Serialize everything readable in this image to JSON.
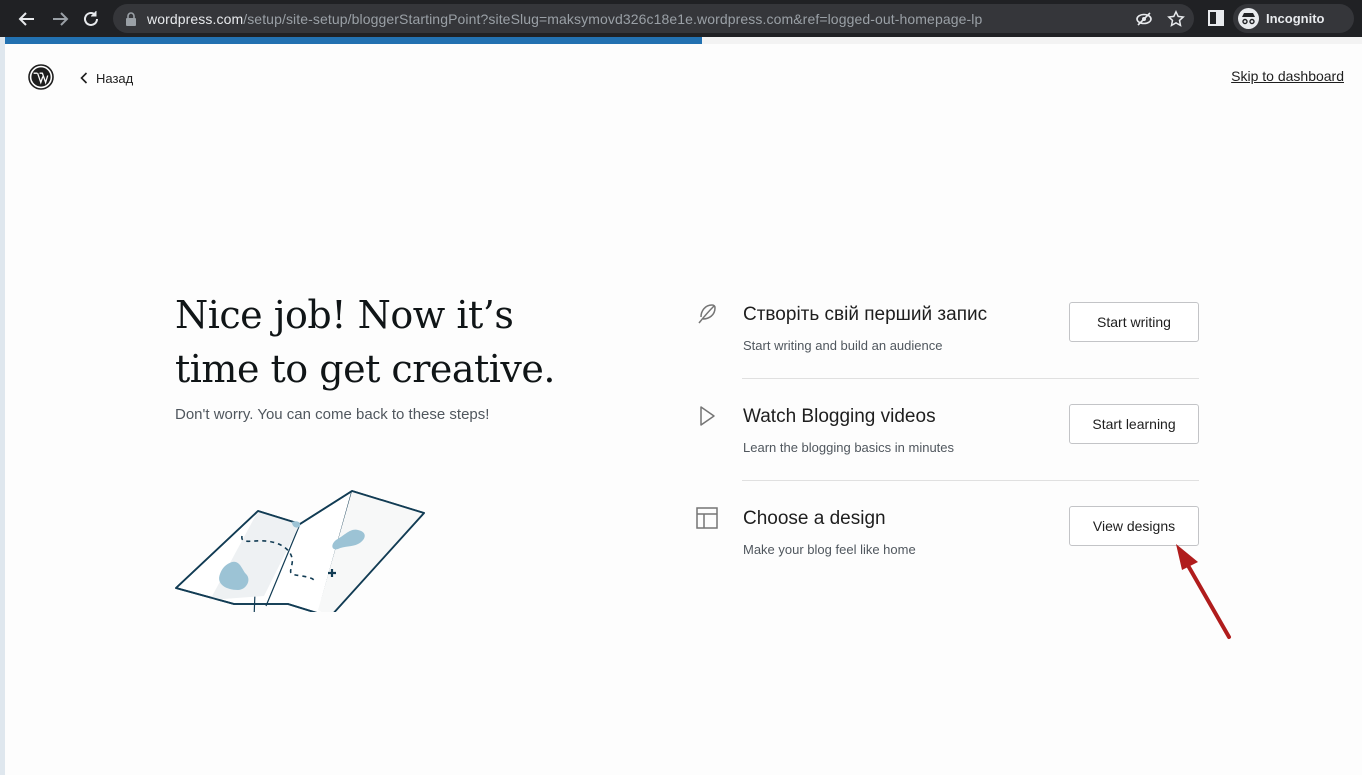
{
  "browser": {
    "url_host": "wordpress.com",
    "url_path": "/setup/site-setup/bloggerStartingPoint?siteSlug=maksymovd326c18e1e.wordpress.com&ref=logged-out-homepage-lp",
    "incognito_label": "Incognito",
    "icons": [
      "back-arrow-icon",
      "forward-arrow-icon",
      "reload-icon",
      "lock-icon",
      "eye-off-icon",
      "star-icon",
      "side-panel-icon",
      "incognito-icon"
    ]
  },
  "progress": {
    "fraction": 0.514,
    "color": "#2271b1"
  },
  "header": {
    "back_label": "Назад",
    "skip_label": "Skip to dashboard"
  },
  "hero": {
    "title_line1": "Nice job! Now it’s",
    "title_line2": "time to get creative.",
    "subtitle": "Don't worry. You can come back to these steps!"
  },
  "tasks": [
    {
      "icon": "feather-icon",
      "title": "Створіть свій перший запис",
      "description": "Start writing and build an audience",
      "button": "Start writing"
    },
    {
      "icon": "play-icon",
      "title": "Watch Blogging videos",
      "description": "Learn the blogging basics in minutes",
      "button": "Start learning"
    },
    {
      "icon": "layout-icon",
      "title": "Choose a design",
      "description": "Make your blog feel like home",
      "button": "View designs"
    }
  ],
  "colors": {
    "accent": "#2271b1",
    "annotation": "#b01c1c",
    "map_blue": "#9cc3d5",
    "map_ink": "#123c54"
  }
}
